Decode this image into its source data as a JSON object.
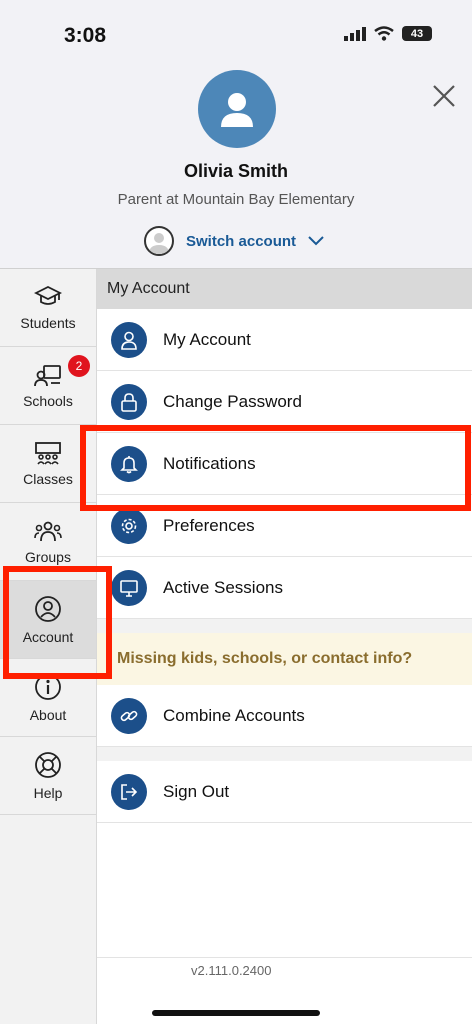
{
  "status_bar": {
    "time": "3:08",
    "battery": "43"
  },
  "profile": {
    "name": "Olivia Smith",
    "role": "Parent at Mountain Bay Elementary",
    "switch_label": "Switch account"
  },
  "sidebar": {
    "items": [
      {
        "label": "Students",
        "icon": "graduation-cap-icon"
      },
      {
        "label": "Schools",
        "icon": "school-icon",
        "badge": "2"
      },
      {
        "label": "Classes",
        "icon": "classroom-icon"
      },
      {
        "label": "Groups",
        "icon": "group-icon"
      },
      {
        "label": "Account",
        "icon": "user-circle-icon",
        "active": true
      },
      {
        "label": "About",
        "icon": "info-icon"
      },
      {
        "label": "Help",
        "icon": "lifebuoy-icon"
      }
    ]
  },
  "main": {
    "section_title": "My Account",
    "items": [
      {
        "label": "My Account",
        "icon": "user-icon"
      },
      {
        "label": "Change Password",
        "icon": "lock-icon"
      },
      {
        "label": "Notifications",
        "icon": "bell-icon"
      },
      {
        "label": "Preferences",
        "icon": "gear-icon"
      },
      {
        "label": "Active Sessions",
        "icon": "monitor-icon"
      }
    ],
    "missing_info": "Missing kids, schools, or contact info?",
    "combine": {
      "label": "Combine Accounts",
      "icon": "link-icon"
    },
    "sign_out": {
      "label": "Sign Out",
      "icon": "sign-out-icon"
    },
    "version": "v2.111.0.2400"
  },
  "colors": {
    "accent": "#1c4f8a",
    "link": "#1a5a96",
    "highlight": "#ff1f00",
    "badge": "#e0141e"
  }
}
